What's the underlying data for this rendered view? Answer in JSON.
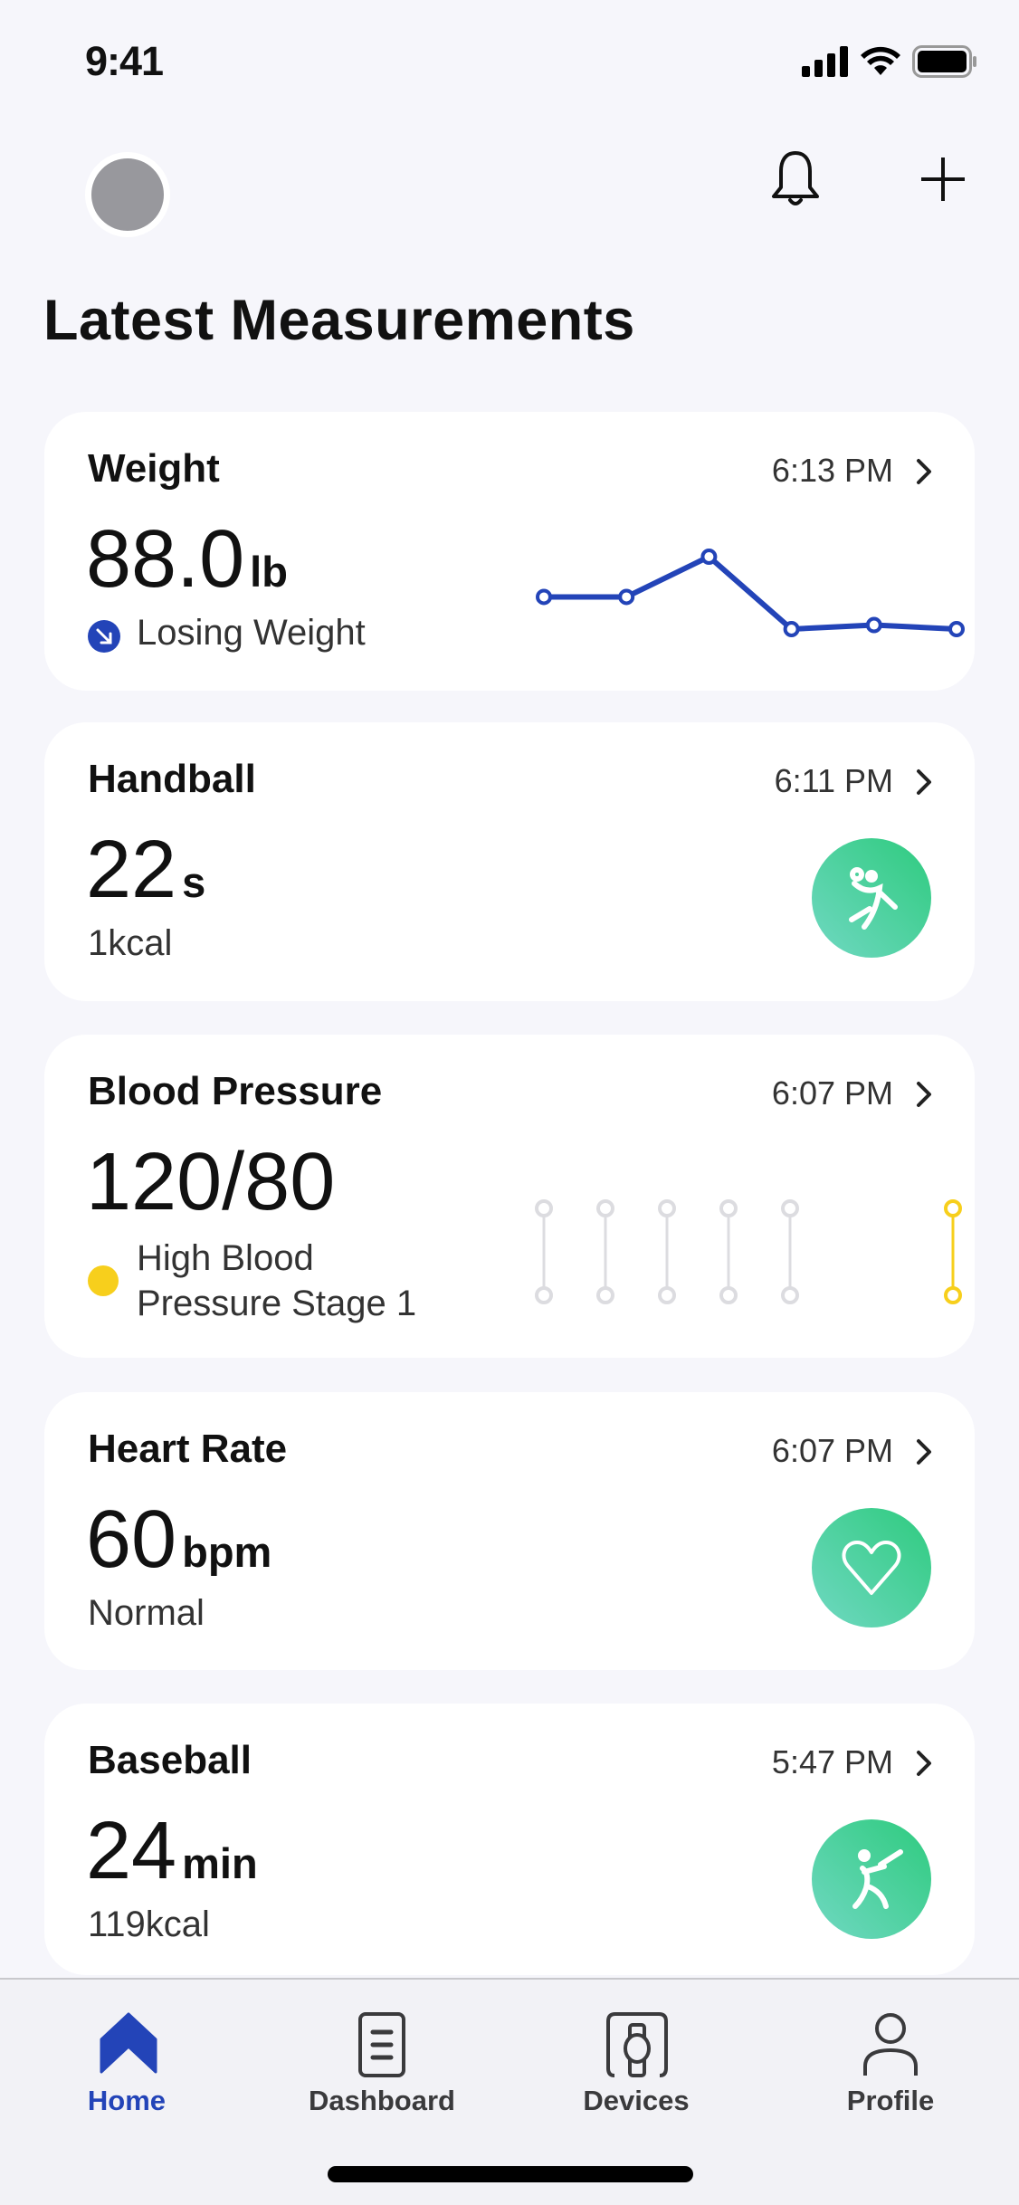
{
  "status_bar": {
    "time": "9:41"
  },
  "header": {
    "title": "Latest Measurements"
  },
  "cards": [
    {
      "title": "Weight",
      "time": "6:13 PM",
      "value": "88.0",
      "unit": "lb",
      "status": "Losing Weight",
      "status_icon": "arrow-down-right-icon",
      "trend_values": [
        3,
        3,
        4,
        2.2,
        2.3,
        2.2
      ]
    },
    {
      "title": "Handball",
      "time": "6:11 PM",
      "value": "22",
      "unit": "s",
      "sub": "1kcal",
      "icon": "handball-icon"
    },
    {
      "title": "Blood Pressure",
      "time": "6:07 PM",
      "value": "120/80",
      "status_line1": "High Blood",
      "status_line2": "Pressure Stage 1",
      "status_color": "#f7cf1c",
      "history_count": 6,
      "highlighted_index": 5
    },
    {
      "title": "Heart Rate",
      "time": "6:07 PM",
      "value": "60",
      "unit": "bpm",
      "sub": "Normal",
      "icon": "heart-icon"
    },
    {
      "title": "Baseball",
      "time": "5:47 PM",
      "value": "24",
      "unit": "min",
      "sub": "119kcal",
      "icon": "baseball-icon"
    }
  ],
  "nav": [
    {
      "label": "Home",
      "active": true
    },
    {
      "label": "Dashboard"
    },
    {
      "label": "Devices"
    },
    {
      "label": "Profile"
    }
  ],
  "colors": {
    "accent": "#2344b8",
    "green": "#2ecb7e",
    "yellow": "#f7cf1c",
    "background": "#f6f6fb"
  }
}
